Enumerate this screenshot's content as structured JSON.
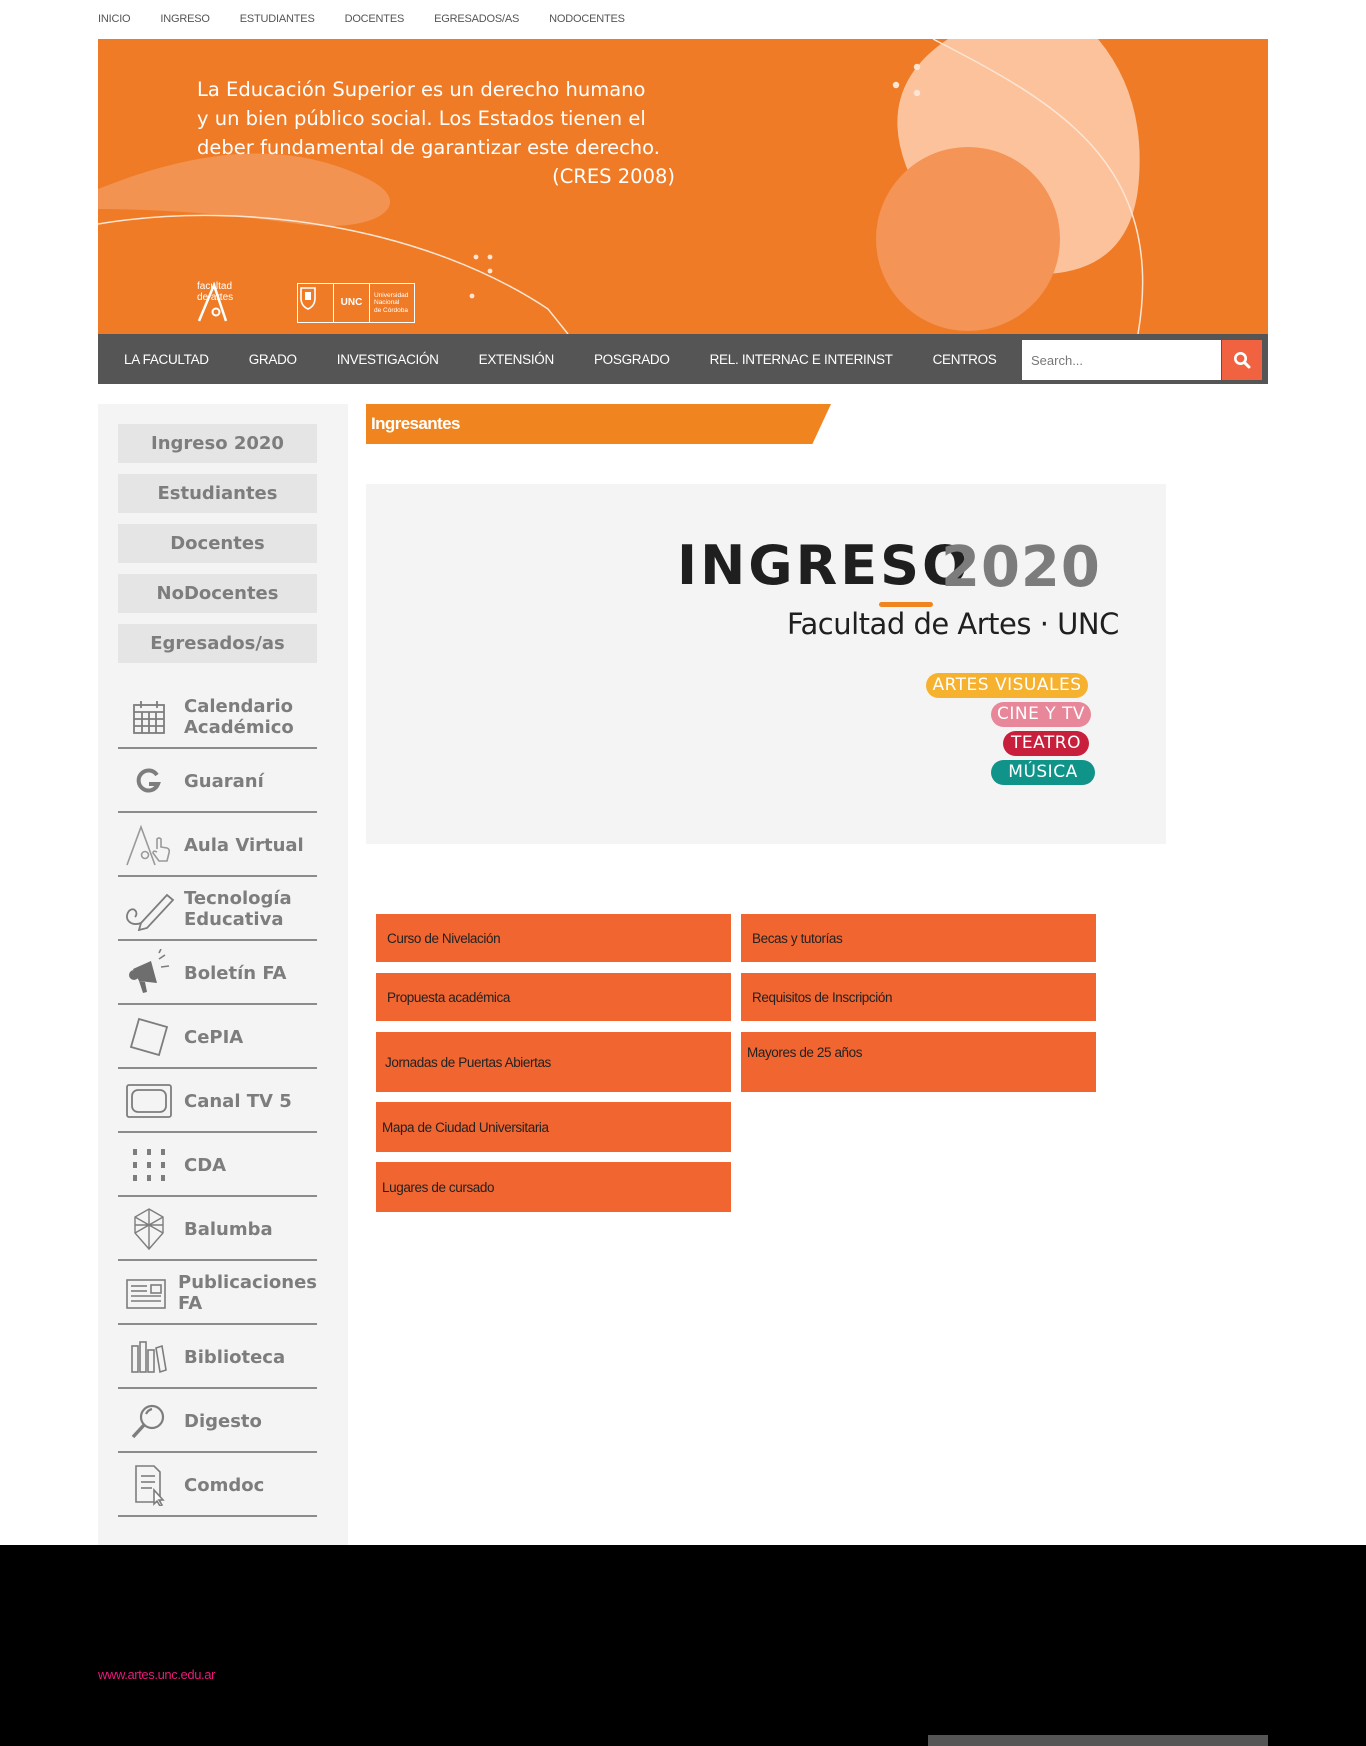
{
  "top_nav": [
    "INICIO",
    "INGRESO",
    "ESTUDIANTES",
    "DOCENTES",
    "EGRESADOS/AS",
    "NODOCENTES"
  ],
  "banner": {
    "quote_lines": [
      "La Educación Superior es un derecho humano",
      "y un bien público social. Los Estados tienen el",
      "deber fundamental de garantizar este derecho."
    ],
    "citation": "(CRES 2008)",
    "logo_fa_text": [
      "facultad",
      "de artes"
    ],
    "logo_unc_text": "UNC",
    "logo_unc_name": [
      "Universidad",
      "Nacional",
      "de Córdoba"
    ]
  },
  "main_nav": [
    "LA FACULTAD",
    "GRADO",
    "INVESTIGACIÓN",
    "EXTENSIÓN",
    "POSGRADO",
    "REL. INTERNAC E INTERINST",
    "CENTROS"
  ],
  "search": {
    "placeholder": "Search..."
  },
  "sidebar": {
    "buttons": [
      "Ingreso 2020",
      "Estudiantes",
      "Docentes",
      "NoDocentes",
      "Egresados/as"
    ],
    "links": [
      {
        "label": [
          "Calendario",
          "Académico"
        ],
        "icon": "calendar-icon"
      },
      {
        "label": [
          "Guaraní"
        ],
        "icon": "guarani-icon"
      },
      {
        "label": [
          "Aula Virtual"
        ],
        "icon": "aula-virtual-icon"
      },
      {
        "label": [
          "Tecnología",
          "Educativa"
        ],
        "icon": "pencil-icon"
      },
      {
        "label": [
          "Boletín FA"
        ],
        "icon": "megaphone-icon"
      },
      {
        "label": [
          "CePIA"
        ],
        "icon": "cepia-icon"
      },
      {
        "label": [
          "Canal TV 5"
        ],
        "icon": "tv-icon"
      },
      {
        "label": [
          "CDA"
        ],
        "icon": "cda-dots-icon"
      },
      {
        "label": [
          "Balumba"
        ],
        "icon": "balumba-icon"
      },
      {
        "label": [
          "Publicaciones",
          "FA"
        ],
        "icon": "newspaper-icon"
      },
      {
        "label": [
          "Biblioteca"
        ],
        "icon": "books-icon"
      },
      {
        "label": [
          "Digesto"
        ],
        "icon": "magnifier-icon"
      },
      {
        "label": [
          "Comdoc"
        ],
        "icon": "document-icon"
      }
    ]
  },
  "content": {
    "title": "Ingresantes",
    "hero": {
      "word": "INGRESO",
      "year": "2020",
      "subtitle": "Facultad de Artes · UNC",
      "pills": [
        {
          "label": "ARTES VISUALES",
          "color": "#f6b12e"
        },
        {
          "label": "CINE Y TV",
          "color": "#e8869a"
        },
        {
          "label": "TEATRO",
          "color": "#c8203c"
        },
        {
          "label": "MÚSICA",
          "color": "#10948a"
        }
      ]
    },
    "buttons": [
      "Curso de Nivelación",
      "Becas y tutorías",
      "Propuesta académica",
      "Requisitos de Inscripción",
      "Jornadas de Puertas Abiertas",
      "Mayores de 25 años",
      "Mapa de Ciudad Universitaria",
      "Lugares de cursado"
    ]
  },
  "footer": {
    "link": "www.artes.unc.edu.ar"
  },
  "colors": {
    "banner": "#ef7b26",
    "nav": "#555555",
    "accent": "#f06530",
    "title_tab": "#f0851f",
    "footer_link": "#e8197a"
  }
}
